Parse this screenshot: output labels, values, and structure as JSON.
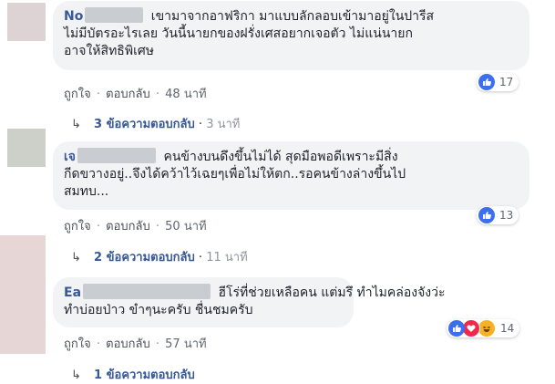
{
  "comments": [
    {
      "author_visible": "No",
      "lines": [
        "เขามาจากอาฟริกา มาแบบลักลอบเข้ามาอยู่ในปารีส",
        "ไม่มีบัตรอะไรเลย วันนี้นายกของฝรั่งเศสอยากเจอตัว ไม่แน่นายก",
        "อาจให้สิทธิพิเศษ"
      ],
      "like_label": "ถูกใจ",
      "reply_label": "ตอบกลับ",
      "time": "48 นาที",
      "reaction_count": "17",
      "reaction_icons": [
        "like-icon"
      ],
      "replies_label": "3 ข้อความตอบกลับ",
      "replies_time": "3 นาที"
    },
    {
      "author_visible": "เจ",
      "lines": [
        "คนข้างบนดึงขึ้นไม่ได้ สุดมือพอดีเพราะมีสิ่ง",
        "กีดขวางอยู่..จึงได้คว้าไว้เฉยๆเพื่อไม่ให้ตก..รอคนข้างล่างขึ้นไป",
        "สมทบ..."
      ],
      "like_label": "ถูกใจ",
      "reply_label": "ตอบกลับ",
      "time": "50 นาที",
      "reaction_count": "13",
      "reaction_icons": [
        "like-icon"
      ],
      "replies_label": "2 ข้อความตอบกลับ",
      "replies_time": "11 นาที"
    },
    {
      "author_visible": "Ea",
      "lines": [
        "ฮีโร่ที่ช่วยเหลือคน แต่มรึ ทำไมคล่องจังว่ะ",
        "ทำบ่อยป่าว ขำๆนะครับ ชื่นชมครับ"
      ],
      "like_label": "ถูกใจ",
      "reply_label": "ตอบกลับ",
      "time": "57 นาที",
      "reaction_count": "14",
      "reaction_icons": [
        "like-icon",
        "love-icon",
        "haha-icon"
      ],
      "replies_label": "1 ข้อความตอบกลับ",
      "replies_time": ""
    }
  ],
  "separator": "·",
  "colors": {
    "like_blue": "#3b6ff0",
    "love_red": "#f0284a",
    "haha_yellow": "#f7b125",
    "link_blue": "#365899",
    "author_blue": "#385898",
    "bubble_bg": "#f2f3f5"
  }
}
